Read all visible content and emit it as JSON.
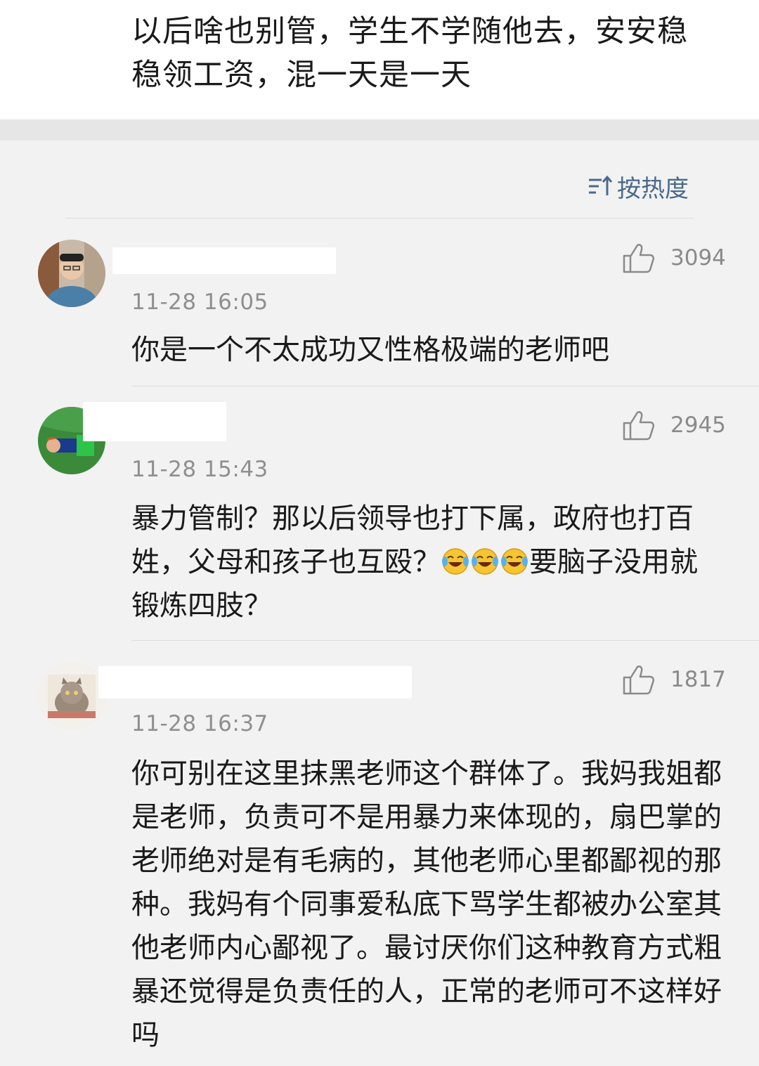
{
  "post": {
    "text": "以后啥也别管，学生不学随他去，安安稳稳领工资，混一天是一天"
  },
  "sort": {
    "label": "按热度"
  },
  "comments": [
    {
      "likes": "3094",
      "time": "11-28 16:05",
      "text": "你是一个不太成功又性格极端的老师吧"
    },
    {
      "likes": "2945",
      "time": "11-28 15:43",
      "text_before": "暴力管制？那以后领导也打下属，政府也打百姓，父母和孩子也互殴？",
      "emoji": "laughing-crying-emoji",
      "text_after": "要脑子没用就锻炼四肢？"
    },
    {
      "likes": "1817",
      "time": "11-28 16:37",
      "text": "你可别在这里抹黑老师这个群体了。我妈我姐都是老师，负责可不是用暴力来体现的，扇巴掌的老师绝对是有毛病的，其他老师心里都鄙视的那种。我妈有个同事爱私底下骂学生都被办公室其他老师内心鄙视了。最讨厌你们这种教育方式粗暴还觉得是负责任的人，正常的老师可不这样好吗"
    }
  ],
  "colors": {
    "accent": "#4a6a8a",
    "meta": "#8f8f8f",
    "background": "#f2f2f2"
  }
}
